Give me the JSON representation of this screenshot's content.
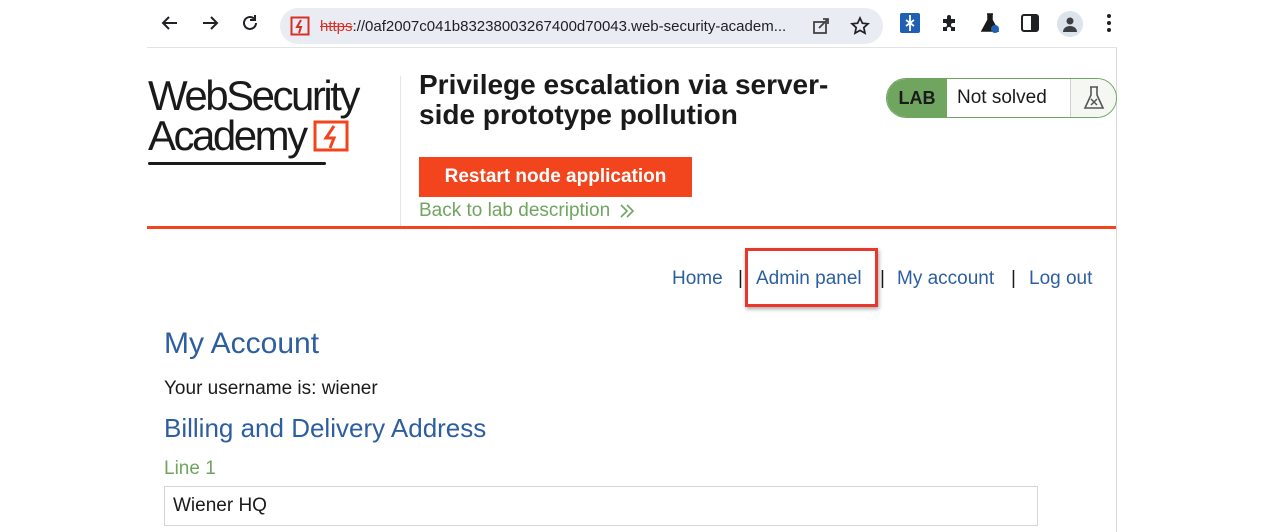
{
  "browser": {
    "url_scheme": "https",
    "url_rest": "://0af2007c041b83238003267400d70043.web-security-academ...",
    "icons": {
      "back": "arrow-left-icon",
      "forward": "arrow-right-icon",
      "reload": "reload-icon",
      "share": "share-icon",
      "bookmark": "star-icon",
      "extensions": [
        "burp-extension-icon",
        "puzzle-icon",
        "flask-extension-icon"
      ],
      "sidepanel": "side-panel-icon",
      "profile": "profile-icon",
      "menu": "kebab-menu-icon"
    }
  },
  "lab": {
    "logo_line1": "WebSecurity",
    "logo_line2": "Academy",
    "title": "Privilege escalation via server-side prototype pollution",
    "restart_label": "Restart node application",
    "back_label": "Back to lab description",
    "status_badge": "LAB",
    "status_text": "Not solved",
    "accent_color": "#f2451d",
    "green_color": "#70a560"
  },
  "nav": {
    "items": [
      "Home",
      "Admin panel",
      "My account",
      "Log out"
    ],
    "separator": "|",
    "highlighted": "Admin panel"
  },
  "account": {
    "title": "My Account",
    "username_line": "Your username is: wiener",
    "billing_title": "Billing and Delivery Address",
    "line1_label": "Line 1",
    "line1_value": "Wiener HQ"
  }
}
